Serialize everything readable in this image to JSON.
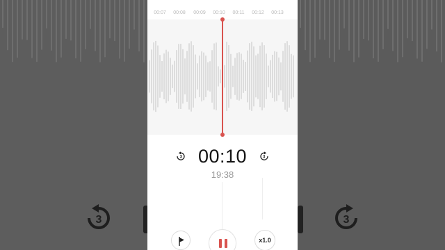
{
  "timeline": {
    "ticks": [
      "00:07",
      "00:08",
      "00:09",
      "00:10",
      "00:11",
      "00:12",
      "00:13"
    ]
  },
  "player": {
    "elapsed": "00:10",
    "total": "19:38",
    "speed": "x1.0",
    "skip_back_seconds": "3",
    "skip_forward_seconds": "3"
  },
  "colors": {
    "playhead": "#d9534f",
    "pause_icon": "#d9534f",
    "wave": "#c4c4c4"
  },
  "icons": {
    "skip_back": "rewind-3s-icon",
    "skip_forward": "forward-3s-icon",
    "flag": "flag-icon",
    "pause": "pause-icon"
  }
}
